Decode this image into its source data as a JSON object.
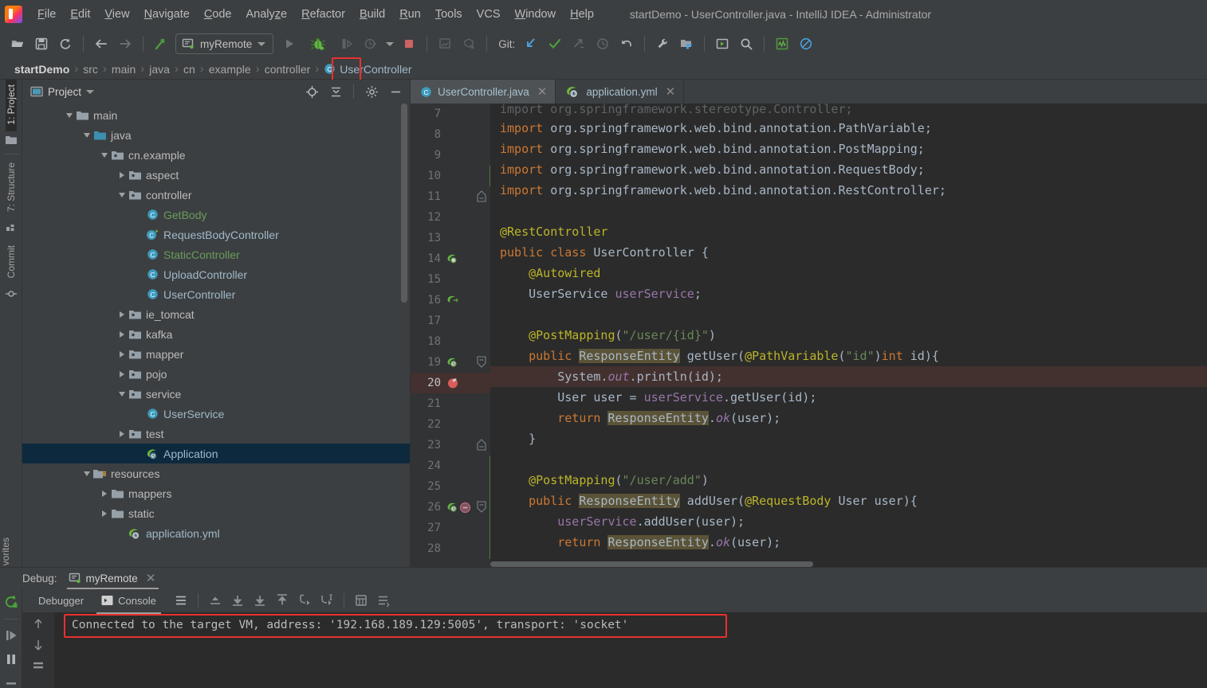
{
  "window": {
    "title": "startDemo - UserController.java - IntelliJ IDEA - Administrator",
    "logo_icon": "intellij-idea-logo"
  },
  "menubar": {
    "items": [
      {
        "label": "File",
        "mnemonic": "F"
      },
      {
        "label": "Edit",
        "mnemonic": "E"
      },
      {
        "label": "View",
        "mnemonic": "V"
      },
      {
        "label": "Navigate",
        "mnemonic": "N"
      },
      {
        "label": "Code",
        "mnemonic": "C"
      },
      {
        "label": "Analyze",
        "mnemonic": "z"
      },
      {
        "label": "Refactor",
        "mnemonic": "R"
      },
      {
        "label": "Build",
        "mnemonic": "B"
      },
      {
        "label": "Run",
        "mnemonic": "R"
      },
      {
        "label": "Tools",
        "mnemonic": "T"
      },
      {
        "label": "VCS",
        "mnemonic": ""
      },
      {
        "label": "Window",
        "mnemonic": "W"
      },
      {
        "label": "Help",
        "mnemonic": "H"
      }
    ]
  },
  "toolbar": {
    "open_icon": "open-folder-icon",
    "save_icon": "save-icon",
    "sync_icon": "refresh-sync-icon",
    "back_icon": "arrow-back-icon",
    "forward_icon": "arrow-forward-icon",
    "build_icon": "build-hammer-icon",
    "run_config": "myRemote",
    "run_config_icon": "remote-debug-config-icon",
    "run_icon": "run-play-icon",
    "debug_icon": "debug-bug-icon",
    "run_with_coverage_icon": "run-coverage-icon",
    "profiler_icon": "profiler-clock-icon",
    "stop_icon": "stop-square-icon",
    "sdk_icon": "device-icon",
    "update_icon": "update-package-icon",
    "git_label": "Git:",
    "git_update_icon": "git-update-arrow-icon",
    "git_commit_icon": "git-commit-check-icon",
    "git_push_icon": "git-push-icon",
    "git_history_icon": "git-history-clock-icon",
    "git_rollback_icon": "git-rollback-undo-icon",
    "settings_icon": "wrench-settings-icon",
    "project-structure_icon": "project-structure-icon",
    "terminal_icon": "terminal-run-icon",
    "search_icon": "search-magnifier-icon",
    "monitor_icon": "activity-monitor-icon",
    "disable_icon": "no-entry-disable-icon",
    "debug_highlight_color": "#e83030"
  },
  "breadcrumb": {
    "separator": "›",
    "items": [
      "startDemo",
      "src",
      "main",
      "java",
      "cn",
      "example",
      "controller"
    ],
    "file": "UserController",
    "file_icon": "java-class-icon"
  },
  "left_toolstrip": {
    "project_tab": "1: Project",
    "project_icon": "folder-icon",
    "structure_tab": "7: Structure",
    "structure_icon": "structure-blocks-icon",
    "commit_tab": "Commit",
    "commit_icon": "commit-node-icon",
    "favorites_tab": "vorites"
  },
  "project_panel": {
    "title": "Project",
    "title_icon": "project-view-icon",
    "dropdown_icon": "chevron-down-icon",
    "locate_icon": "target-crosshair-icon",
    "collapse_icon": "collapse-all-icon",
    "settings_icon": "gear-icon",
    "hide_icon": "minimize-icon",
    "tree": [
      {
        "label": "main",
        "indent": 2,
        "state": "open",
        "icon": "folder-icon",
        "color": "#bbbbbb"
      },
      {
        "label": "java",
        "indent": 3,
        "state": "open",
        "icon": "source-folder-icon",
        "color": "#bbbbbb"
      },
      {
        "label": "cn.example",
        "indent": 4,
        "state": "open",
        "icon": "package-icon",
        "color": "#bbbbbb"
      },
      {
        "label": "aspect",
        "indent": 5,
        "state": "closed",
        "icon": "package-icon",
        "color": "#bbbbbb"
      },
      {
        "label": "controller",
        "indent": 5,
        "state": "open",
        "icon": "package-icon",
        "color": "#bbbbbb"
      },
      {
        "label": "GetBody",
        "indent": 6,
        "state": "leaf",
        "icon": "java-class-icon",
        "color": "#6a9b5b"
      },
      {
        "label": "RequestBodyController",
        "indent": 6,
        "state": "leaf",
        "icon": "java-class-spring-icon",
        "color": "#9fb8c9"
      },
      {
        "label": "StaticController",
        "indent": 6,
        "state": "leaf",
        "icon": "java-class-icon",
        "color": "#6a9b5b"
      },
      {
        "label": "UploadController",
        "indent": 6,
        "state": "leaf",
        "icon": "java-class-icon",
        "color": "#9fb8c9"
      },
      {
        "label": "UserController",
        "indent": 6,
        "state": "leaf",
        "icon": "java-class-icon",
        "color": "#9fb8c9"
      },
      {
        "label": "ie_tomcat",
        "indent": 5,
        "state": "closed",
        "icon": "package-icon",
        "color": "#bbbbbb"
      },
      {
        "label": "kafka",
        "indent": 5,
        "state": "closed",
        "icon": "package-icon",
        "color": "#bbbbbb"
      },
      {
        "label": "mapper",
        "indent": 5,
        "state": "closed",
        "icon": "package-icon",
        "color": "#bbbbbb"
      },
      {
        "label": "pojo",
        "indent": 5,
        "state": "closed",
        "icon": "package-icon",
        "color": "#bbbbbb"
      },
      {
        "label": "service",
        "indent": 5,
        "state": "open",
        "icon": "package-icon",
        "color": "#bbbbbb"
      },
      {
        "label": "UserService",
        "indent": 6,
        "state": "leaf",
        "icon": "java-class-icon",
        "color": "#9fb8c9"
      },
      {
        "label": "test",
        "indent": 5,
        "state": "closed",
        "icon": "package-icon",
        "color": "#bbbbbb"
      },
      {
        "label": "Application",
        "indent": 6,
        "state": "leaf",
        "icon": "spring-boot-app-icon",
        "color": "#9fb8c9",
        "selected": true
      },
      {
        "label": "resources",
        "indent": 3,
        "state": "open",
        "icon": "resources-folder-icon",
        "color": "#bbbbbb"
      },
      {
        "label": "mappers",
        "indent": 4,
        "state": "closed",
        "icon": "folder-icon",
        "color": "#bbbbbb"
      },
      {
        "label": "static",
        "indent": 4,
        "state": "closed",
        "icon": "folder-icon",
        "color": "#bbbbbb"
      },
      {
        "label": "application.yml",
        "indent": 5,
        "state": "leaf",
        "icon": "spring-yml-icon",
        "color": "#9fb8c9"
      }
    ]
  },
  "editor": {
    "tabs": [
      {
        "label": "UserController.java",
        "icon": "java-class-icon",
        "active": true,
        "close_icon": "close-icon"
      },
      {
        "label": "application.yml",
        "icon": "spring-yml-icon",
        "active": false,
        "close_icon": "close-icon"
      }
    ],
    "lines": [
      {
        "num": "7",
        "text": "import org.springframework.stereotype.Controller;",
        "clipped": true
      },
      {
        "num": "8",
        "text": "import org.springframework.web.bind.annotation.PathVariable;"
      },
      {
        "num": "9",
        "text": "import org.springframework.web.bind.annotation.PostMapping;"
      },
      {
        "num": "10",
        "text": "import org.springframework.web.bind.annotation.RequestBody;",
        "changed": true
      },
      {
        "num": "11",
        "text": "import org.springframework.web.bind.annotation.RestController;",
        "fold": "end"
      },
      {
        "num": "12",
        "text": ""
      },
      {
        "num": "13",
        "text": "@RestController"
      },
      {
        "num": "14",
        "text": "public class UserController {",
        "gutter_icon": "spring-bean-icon"
      },
      {
        "num": "15",
        "text": "    @Autowired"
      },
      {
        "num": "16",
        "text": "    UserService userService;",
        "gutter_icon": "spring-autowired-icon"
      },
      {
        "num": "17",
        "text": ""
      },
      {
        "num": "18",
        "text": "    @PostMapping(\"/user/{id}\")"
      },
      {
        "num": "19",
        "text": "    public ResponseEntity getUser(@PathVariable(\"id\")int id){",
        "gutter_icon": "spring-mapping-icon",
        "fold": "start"
      },
      {
        "num": "20",
        "text": "        System.out.println(id);",
        "breakpoint": true,
        "highlight": true
      },
      {
        "num": "21",
        "text": "        User user = userService.getUser(id);"
      },
      {
        "num": "22",
        "text": "        return ResponseEntity.ok(user);"
      },
      {
        "num": "23",
        "text": "    }",
        "fold": "end"
      },
      {
        "num": "24",
        "text": "",
        "changed": true
      },
      {
        "num": "25",
        "text": "    @PostMapping(\"/user/add\")",
        "changed": true
      },
      {
        "num": "26",
        "text": "    public ResponseEntity addUser(@RequestBody User user){",
        "gutter_icon": "spring-mapping-icon",
        "gutter_icon2": "breakpoint-muted-icon",
        "fold": "start",
        "changed": true
      },
      {
        "num": "27",
        "text": "        userService.addUser(user);",
        "changed": true
      },
      {
        "num": "28",
        "text": "        return ResponseEntity.ok(user);",
        "changed": true
      }
    ]
  },
  "debug": {
    "label": "Debug:",
    "session": "myRemote",
    "session_icon": "remote-debug-config-icon",
    "close_icon": "close-icon",
    "rerun_icon": "rerun-debug-icon",
    "resume_icon": "resume-program-icon",
    "pause_icon": "pause-program-icon",
    "stop_icon": "stop-icon",
    "tabs": [
      {
        "label": "Debugger",
        "icon": "",
        "active": false
      },
      {
        "label": "Console",
        "icon": "console-icon",
        "active": true
      }
    ],
    "toolbar_icons": [
      "settings-lines-icon",
      "step-out-icon",
      "step-over-icon",
      "step-into-icon",
      "force-step-into-icon",
      "smart-step-into-icon",
      "run-to-cursor-icon",
      "evaluate-expression-icon",
      "layout-settings-icon"
    ],
    "console_gutter_icons": [
      "scroll-up-icon",
      "scroll-down-icon",
      "soft-wrap-icon"
    ],
    "console_text": "Connected to the target VM, address: '192.168.189.129:5005', transport: 'socket'",
    "console_highlight_color": "#e83030"
  },
  "colors": {
    "chrome_bg": "#3c3f41",
    "editor_bg": "#2b2b2b",
    "gutter_bg": "#313335",
    "selection_bg": "#0d293e",
    "breakpoint_line_bg": "#43312f",
    "accent_red": "#e83030",
    "keyword": "#cc7832",
    "annotation": "#bbb529",
    "string": "#6a8759",
    "field": "#9876aa",
    "text": "#a9b7c6"
  }
}
